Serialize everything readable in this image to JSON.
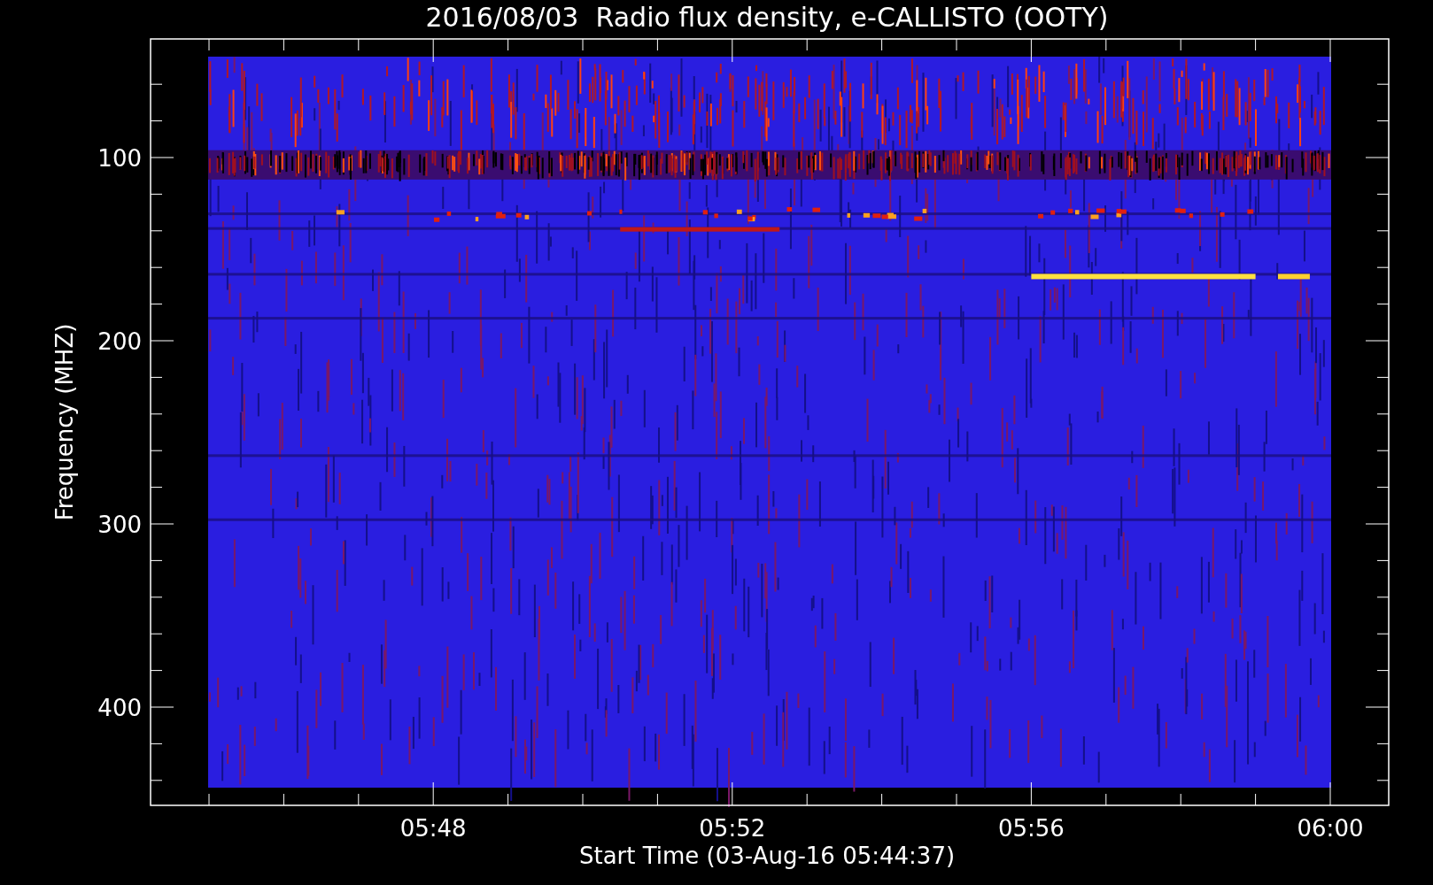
{
  "plot": {
    "title": "2016/08/03  Radio flux density, e-CALLISTO (OOTY)",
    "ylabel": "Frequency (MHZ)",
    "xlabel": "Start Time (03-Aug-16 05:44:37)",
    "yticks": [
      "100",
      "200",
      "300",
      "400"
    ],
    "xticks": [
      "05:48",
      "05:52",
      "05:56",
      "06:00"
    ]
  }
}
